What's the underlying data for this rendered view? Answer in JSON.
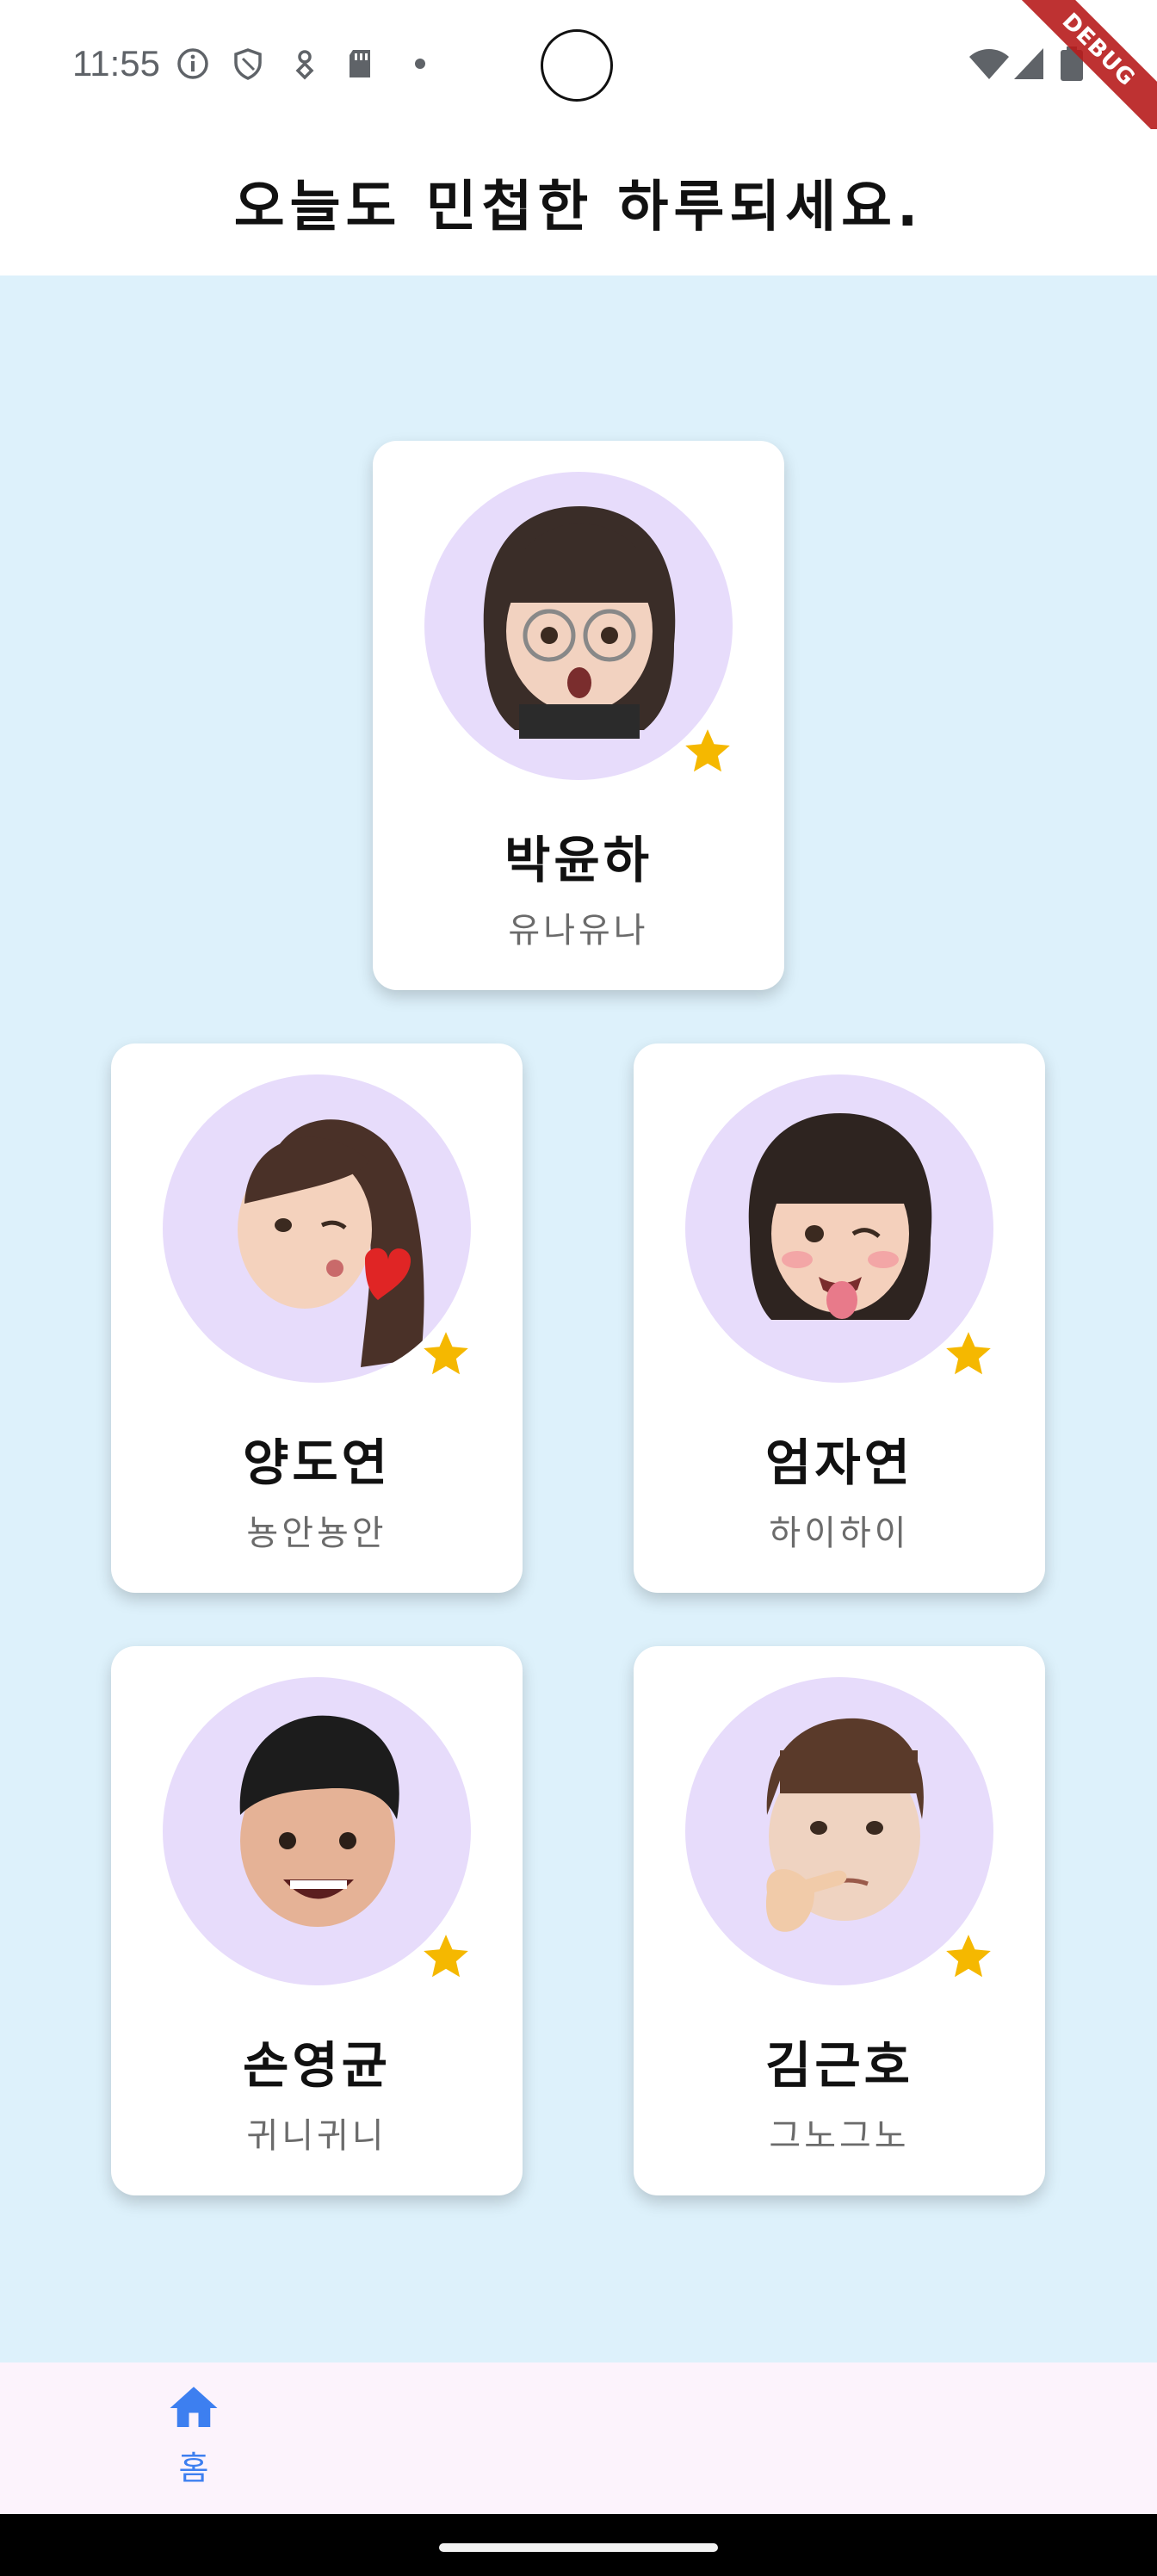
{
  "status_bar": {
    "time": "11:55",
    "icons": [
      "info-icon",
      "shield-icon",
      "location-icon",
      "sd-card-icon",
      "dot-icon",
      "wifi-icon",
      "signal-icon",
      "battery-icon"
    ],
    "debug_label": "DEBUG"
  },
  "app_bar": {
    "title": "오늘도 민첩한 하루되세요."
  },
  "cards": [
    {
      "name": "박윤하",
      "nickname": "유나유나",
      "avatar": "girl-glasses-avatar",
      "favorite": true
    },
    {
      "name": "양도연",
      "nickname": "뇽안뇽안",
      "avatar": "girl-kiss-heart-avatar",
      "favorite": true
    },
    {
      "name": "엄자연",
      "nickname": "하이하이",
      "avatar": "girl-tongue-wink-avatar",
      "favorite": true
    },
    {
      "name": "손영균",
      "nickname": "귀니귀니",
      "avatar": "boy-smile-avatar",
      "favorite": true
    },
    {
      "name": "김근호",
      "nickname": "그노그노",
      "avatar": "boy-thinking-avatar",
      "favorite": true
    }
  ],
  "bottom_nav": {
    "items": [
      {
        "label": "홈",
        "icon": "home-icon",
        "selected": true
      }
    ]
  },
  "colors": {
    "background": "#ddf1fb",
    "avatar_bg": "#e7dcfb",
    "star": "#f5b800",
    "nav_accent": "#3d7ff0",
    "nav_bg": "#fcf3fc"
  }
}
